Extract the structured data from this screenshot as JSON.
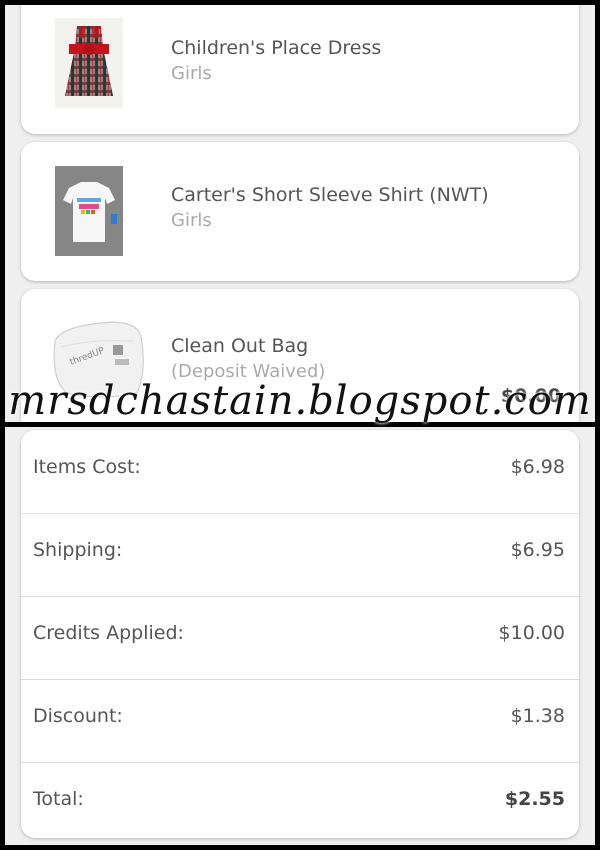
{
  "items": [
    {
      "name": "Children's Place Dress",
      "subtitle": "Girls",
      "image_icon": "plaid-dress-photo"
    },
    {
      "name": "Carter's Short Sleeve Shirt (NWT)",
      "subtitle": "Girls",
      "image_icon": "white-tshirt-photo"
    },
    {
      "name": "Clean Out Bag",
      "subtitle": "(Deposit Waived)",
      "price": "$0.00",
      "image_icon": "white-bag-photo"
    }
  ],
  "summary": {
    "items_cost_label": "Items Cost:",
    "items_cost_value": "$6.98",
    "shipping_label": "Shipping:",
    "shipping_value": "$6.95",
    "credits_label": "Credits Applied:",
    "credits_value": "$10.00",
    "discount_label": "Discount:",
    "discount_value": "$1.38",
    "total_label": "Total:",
    "total_value": "$2.55"
  },
  "watermark": "mrsdchastain.blogspot.com",
  "colors": {
    "background": "#efefef",
    "card": "#ffffff",
    "text": "#555555",
    "subtext": "#aaaaaa",
    "dress_red": "#c4151c"
  }
}
